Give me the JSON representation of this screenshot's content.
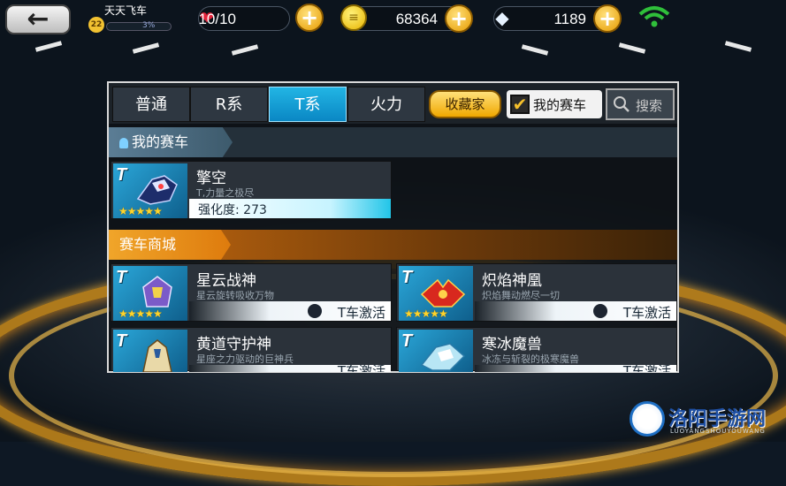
{
  "hud": {
    "back_glyph": "←",
    "player_name": "天天飞车",
    "level": "22",
    "xp_text": "3%",
    "hearts": "10/10",
    "coins": "68364",
    "diamonds": "1189"
  },
  "tabs": [
    {
      "label": "普通",
      "active": false
    },
    {
      "label": "R系",
      "active": false
    },
    {
      "label": "T系",
      "active": true
    },
    {
      "label": "火力",
      "active": false
    }
  ],
  "toolbar": {
    "collect_label": "收藏家",
    "mycar_label": "我的赛车",
    "mycar_checked": "✔",
    "search_label": "搜索"
  },
  "sections": {
    "my_cars": "我的赛车",
    "shop": "赛车商城"
  },
  "my_cars": [
    {
      "name": "擎空",
      "desc": "T,力量之极尽",
      "strength_label": "强化度: 273",
      "stars": "★★★★★",
      "logo": "T"
    }
  ],
  "shop_cars": [
    {
      "name": "星云战神",
      "desc": "星云旋转吸收万物",
      "lock_label": "T车激活",
      "stars": "★★★★★",
      "logo": "T"
    },
    {
      "name": "炽焰神凰",
      "desc": "炽焰舞动燃尽一切",
      "lock_label": "T车激活",
      "stars": "★★★★★",
      "logo": "T"
    },
    {
      "name": "黄道守护神",
      "desc": "星座之力驱动的巨神兵",
      "lock_label": "T车激活",
      "stars": "★★★★★",
      "logo": "T"
    },
    {
      "name": "寒冰魔兽",
      "desc": "冰冻与斩裂的极寒魔兽",
      "lock_label": "T车激活",
      "stars": "★★★★★",
      "logo": "T"
    }
  ],
  "watermark": {
    "title": "洛阳手游网",
    "sub": "LUOYANGSHOUYOUWANG"
  },
  "colors": {
    "accent_blue": "#0a87c4",
    "gold": "#f0a800",
    "shop_orange": "#de7b0d"
  }
}
